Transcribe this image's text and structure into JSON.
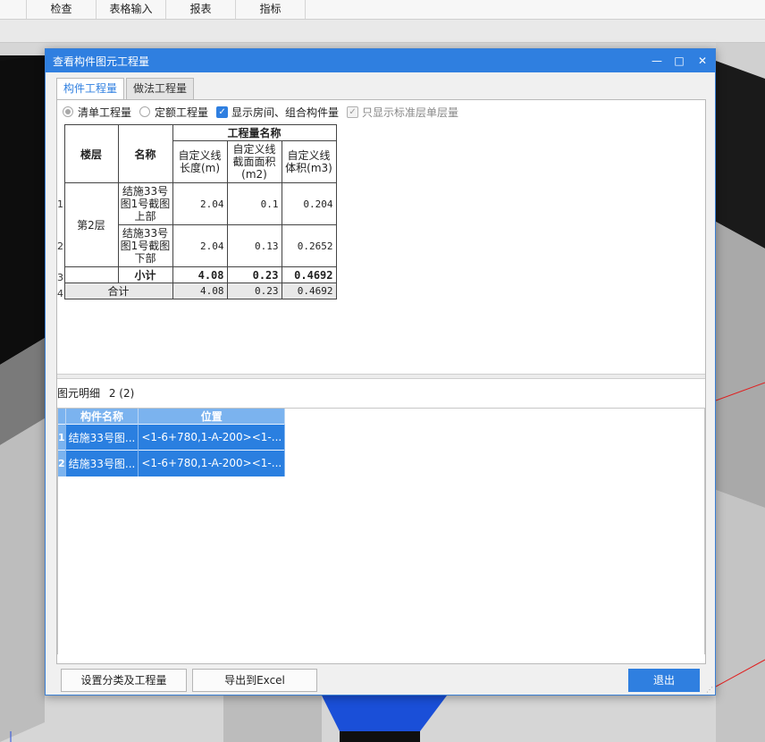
{
  "menu": [
    "检查",
    "表格输入",
    "报表",
    "指标"
  ],
  "dialog": {
    "title": "查看构件图元工程量",
    "minimize_glyph": "—",
    "maximize_glyph": "□",
    "close_glyph": "✕",
    "tabs": [
      "构件工程量",
      "做法工程量"
    ],
    "options": {
      "radio_list": "清单工程量",
      "radio_quota": "定额工程量",
      "check_rooms": "显示房间、组合构件量",
      "check_std_floor": "只显示标准层单层量"
    },
    "table": {
      "col_floor": "楼层",
      "col_name": "名称",
      "group_header": "工程量名称",
      "col_length": "自定义线长度(m)",
      "col_area": "自定义线截面面积(m2)",
      "col_volume": "自定义线体积(m3)",
      "row_numbers": [
        "1",
        "2",
        "3",
        "4"
      ],
      "floor": "第2层",
      "rows": [
        {
          "name": "结施33号图1号截图上部",
          "length": "2.04",
          "area": "0.1",
          "volume": "0.204"
        },
        {
          "name": "结施33号图1号截图下部",
          "length": "2.04",
          "area": "0.13",
          "volume": "0.2652"
        }
      ],
      "subtotal": {
        "label": "小计",
        "length": "4.08",
        "area": "0.23",
        "volume": "0.4692"
      },
      "total": {
        "label": "合计",
        "length": "4.08",
        "area": "0.23",
        "volume": "0.4692"
      }
    },
    "detail": {
      "header": "图元明细",
      "count": "2 (2)",
      "col_name": "构件名称",
      "col_position": "位置",
      "rows": [
        {
          "idx": "1",
          "name": "结施33号图...",
          "position": "<1-6+780,1-A-200><1-..."
        },
        {
          "idx": "2",
          "name": "结施33号图...",
          "position": "<1-6+780,1-A-200><1-..."
        }
      ]
    },
    "buttons": {
      "settings": "设置分类及工程量",
      "export": "导出到Excel",
      "exit": "退出"
    }
  },
  "colors": {
    "accent": "#2f7fe0",
    "row_selected": "#2a7fe0",
    "header_light": "#7bb3ef"
  }
}
